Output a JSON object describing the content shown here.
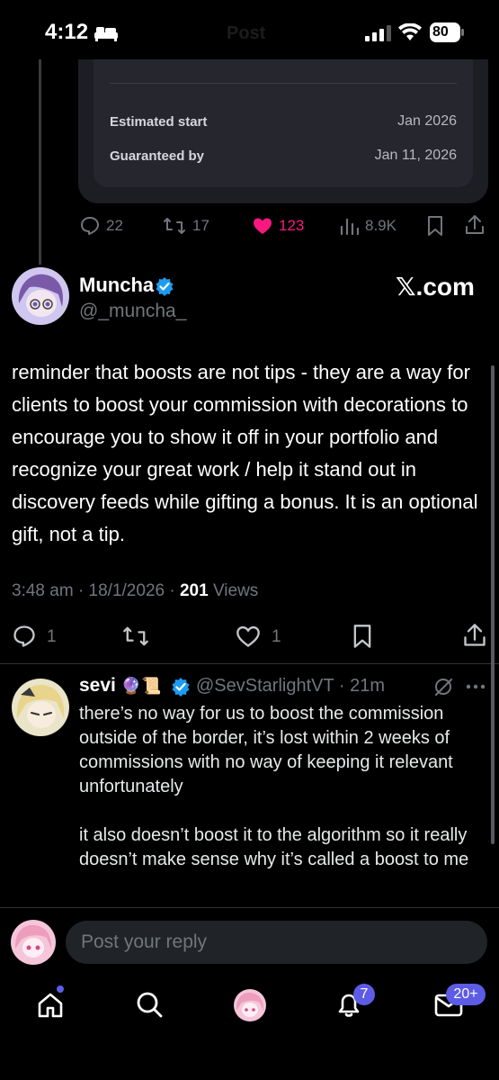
{
  "status_bar": {
    "time": "4:12",
    "battery": "80",
    "ghost_title": "Post"
  },
  "embedded_card": {
    "rows": [
      {
        "label": "Estimated start",
        "value": "Jan 2026"
      },
      {
        "label": "Guaranteed by",
        "value": "Jan 11, 2026"
      }
    ]
  },
  "parent_stats": {
    "replies": "22",
    "reposts": "17",
    "likes": "123",
    "views": "8.9K",
    "like_color": "#f91880"
  },
  "main_tweet": {
    "author_name": "Muncha",
    "author_handle": "@_muncha_",
    "watermark": "𝕏.com",
    "body": "reminder that boosts are not tips - they are a way for clients to boost your commission with decorations to encourage you to show it off in your portfolio and recognize your great work / help it stand out in discovery feeds while gifting a bonus. It is an optional gift, not a tip.",
    "time": "3:48 am",
    "date": "18/1/2026",
    "views_count": "201",
    "views_label": "Views",
    "replies": "1",
    "likes": "1"
  },
  "reply": {
    "author_name": "sevi",
    "author_emoji": "🔮📜",
    "handle": "@SevStarlightVT",
    "time": "21m",
    "body": "there’s no way for us to boost the commission outside of the border, it’s lost within 2 weeks of commissions with no way of keeping it relevant unfortunately\n\nit also doesn’t boost it to the algorithm so it really doesn’t make sense why it’s called a boost to me"
  },
  "composer": {
    "placeholder": "Post your reply"
  },
  "bottom_nav": {
    "notifications_badge": "7",
    "messages_badge": "20+",
    "accent_color": "#5d5ce6"
  },
  "colors": {
    "verified": "#1d9bf0",
    "muted_text": "#71767b"
  }
}
